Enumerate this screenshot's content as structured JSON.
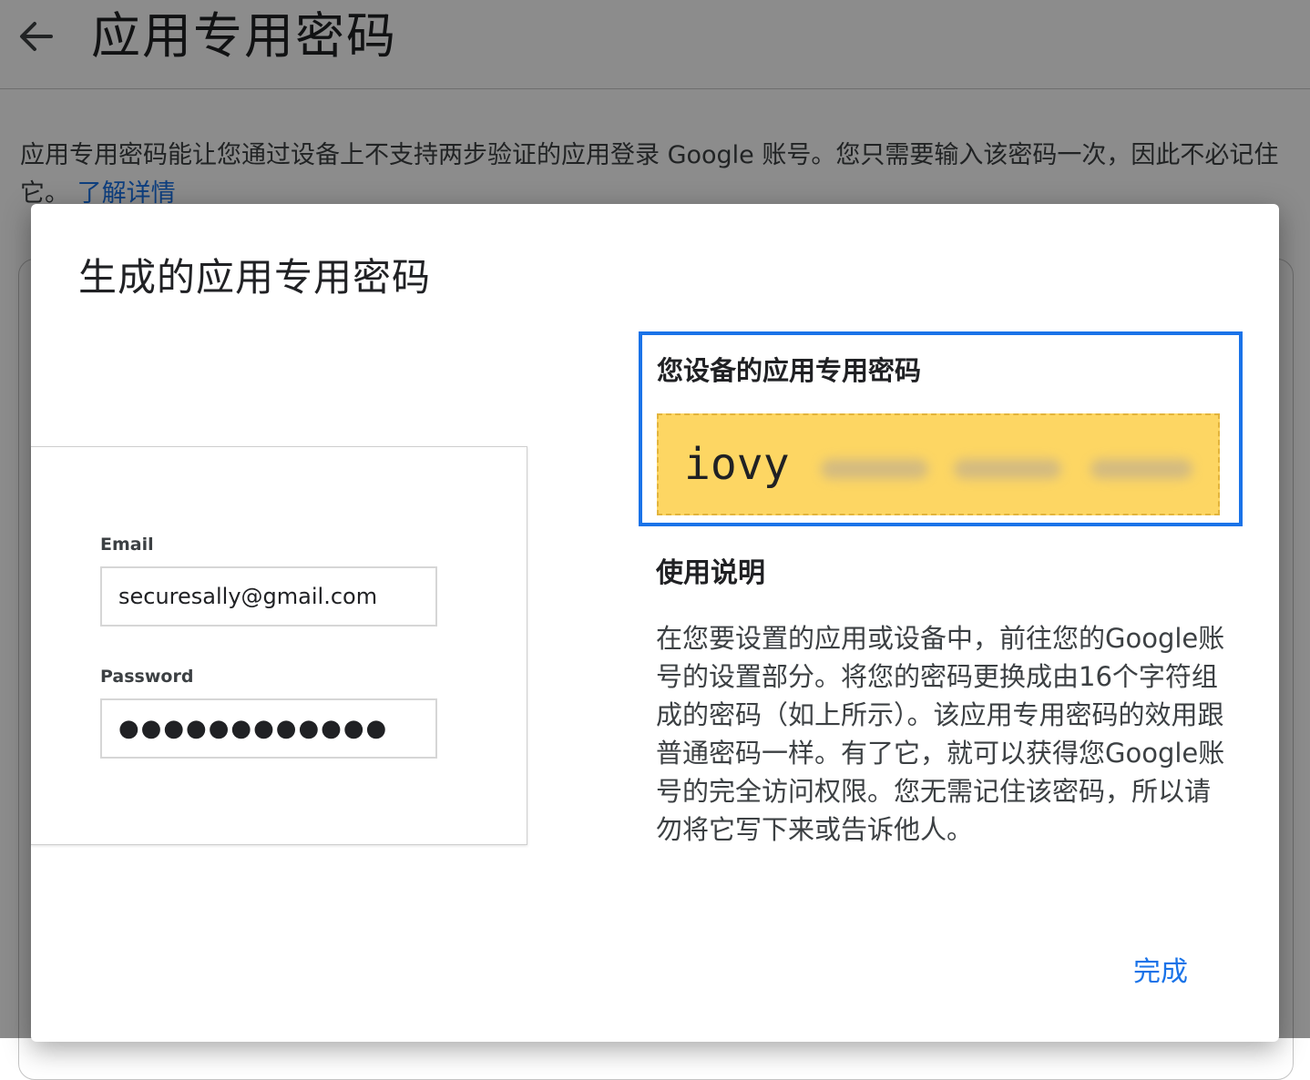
{
  "page": {
    "title": "应用专用密码",
    "intro_text": "应用专用密码能让您通过设备上不支持两步验证的应用登录 Google 账号。您只需要输入该密码一次，因此不必记住它。",
    "learn_more": "了解详情"
  },
  "icons": {
    "back": "arrow-left-icon"
  },
  "dialog": {
    "title": "生成的应用专用密码",
    "login_example": {
      "email_label": "Email",
      "email_value": "securesally@gmail.com",
      "password_label": "Password",
      "password_value": "●●●●●●●●●●●●"
    },
    "password_panel": {
      "label": "您设备的应用专用密码",
      "visible_part": "iovy"
    },
    "usage": {
      "title": "使用说明",
      "text": "在您要设置的应用或设备中，前往您的Google账号的设置部分。将您的密码更换成由16个字符组成的密码（如上所示）。该应用专用密码的效用跟普通密码一样。有了它，就可以获得您Google账号的完全访问权限。您无需记住该密码，所以请勿将它写下来或告诉他人。"
    },
    "done_label": "完成"
  },
  "colors": {
    "accent": "#1a73e8",
    "password_background": "#fdd663",
    "scrim": "rgba(0,0,0,0.45)"
  }
}
